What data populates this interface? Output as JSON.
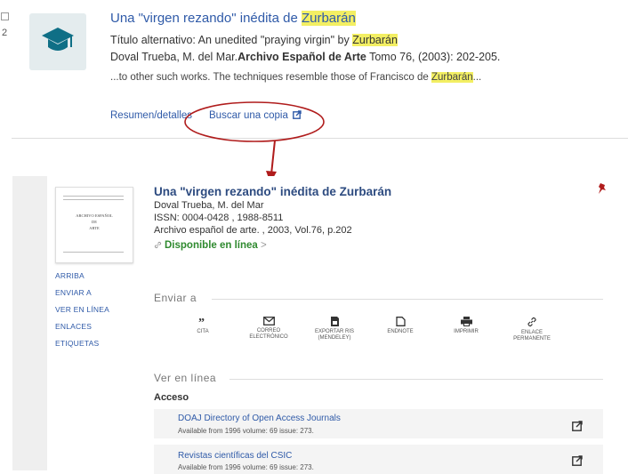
{
  "result": {
    "number": "2",
    "title_pre": "Una \"virgen rezando\" inédita de ",
    "title_hl": "Zurbarán",
    "alt_pre": "Título alternativo: An unedited \"praying virgin\" by ",
    "alt_hl": "Zurbarán",
    "authors": "Doval Trueba, M. del Mar.",
    "journal": "Archivo Español de Arte",
    "citation": " Tomo 76,  (2003): 202-205.",
    "snippet_pre": "...to other such works. The techniques resemble those of Francisco de ",
    "snippet_hl": "Zurbarán",
    "snippet_post": "...",
    "link_summary": "Resumen/detalles",
    "link_copy": "Buscar una copia"
  },
  "record": {
    "title": "Una \"virgen rezando\" inédita de Zurbarán",
    "author": "Doval Trueba, M. del Mar",
    "issn": "ISSN: 0004-0428 , 1988-8511",
    "source": "Archivo español de arte. , 2003, Vol.76, p.202",
    "availability": "Disponible en línea",
    "availability_chevron": ">",
    "cover_title": "ARCHIVO ESPAÑOL",
    "cover_de": "DE",
    "cover_arte": "ARTE"
  },
  "nav": [
    "ARRIBA",
    "ENVIAR A",
    "VER EN LÍNEA",
    "ENLACES",
    "ETIQUETAS"
  ],
  "send_to": {
    "heading": "Enviar a",
    "actions": [
      {
        "line1": "CITA",
        "line2": "",
        "icon": "quote-icon"
      },
      {
        "line1": "CORREO",
        "line2": "ELECTRÓNICO",
        "icon": "envelope-icon"
      },
      {
        "line1": "EXPORTAR RIS",
        "line2": "(MENDELEY)",
        "icon": "export-icon"
      },
      {
        "line1": "ENDNOTE",
        "line2": "",
        "icon": "document-icon"
      },
      {
        "line1": "IMPRIMIR",
        "line2": "",
        "icon": "printer-icon"
      },
      {
        "line1": "ENLACE",
        "line2": "PERMANENTE",
        "icon": "link-icon"
      }
    ]
  },
  "online": {
    "heading": "Ver en línea",
    "access_label": "Acceso",
    "links": [
      {
        "title": "DOAJ Directory of Open Access Journals",
        "sub": "Available from 1996 volume: 69 issue: 273."
      },
      {
        "title": "Revistas científicas del CSIC",
        "sub": "Available from 1996 volume: 69 issue: 273."
      }
    ]
  },
  "colors": {
    "link": "#2f5aa8",
    "highlight": "#f3ef63",
    "annotation": "#b01c1c",
    "available": "#2f8a2f"
  }
}
